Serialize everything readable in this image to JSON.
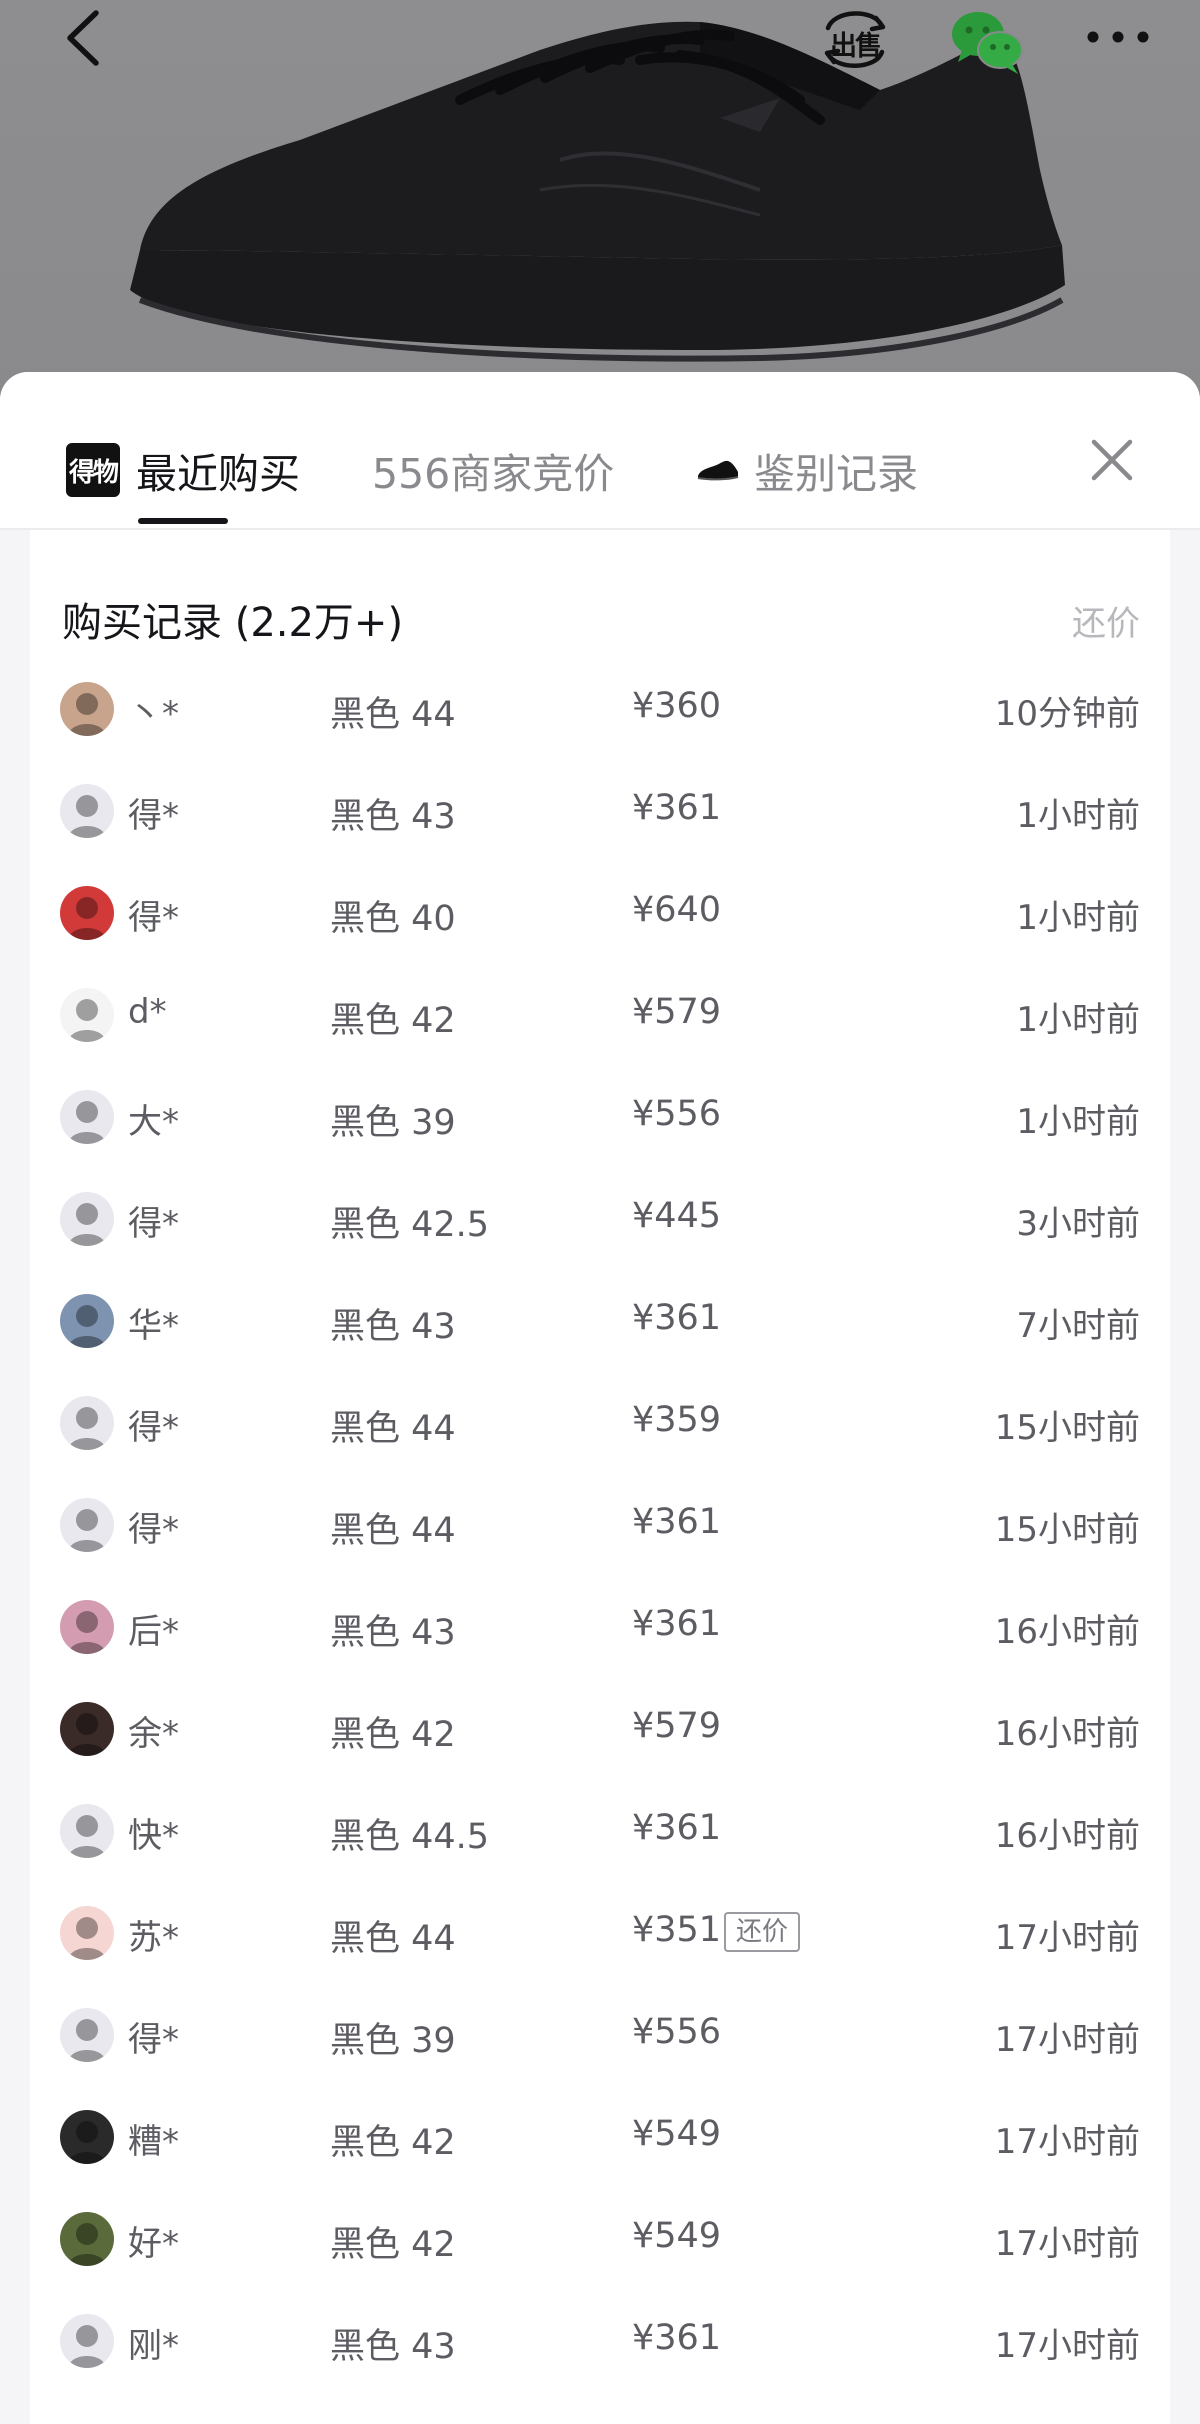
{
  "header": {
    "back_icon": "chevron-left-icon",
    "sell_label": "出售",
    "share_icon": "wechat-icon",
    "more_icon": "more-dots-icon"
  },
  "tabs": {
    "recent": {
      "logo_text": "得物",
      "label": "最近购买"
    },
    "bids": {
      "label": "556商家竞价"
    },
    "auth": {
      "label": "鉴别记录"
    },
    "close_icon": "close-icon"
  },
  "records": {
    "title": "购买记录 (2.2万+)",
    "action": "还价",
    "items": [
      {
        "name": "丶*",
        "spec": "黑色 44",
        "price": "¥360",
        "badge": "",
        "time": "10分钟前",
        "avatar": "#c8a48c"
      },
      {
        "name": "得*",
        "spec": "黑色 43",
        "price": "¥361",
        "badge": "",
        "time": "1小时前",
        "avatar": "#e8e8ee"
      },
      {
        "name": "得*",
        "spec": "黑色 40",
        "price": "¥640",
        "badge": "",
        "time": "1小时前",
        "avatar": "#d23a3a"
      },
      {
        "name": "d*",
        "spec": "黑色 42",
        "price": "¥579",
        "badge": "",
        "time": "1小时前",
        "avatar": "#f4f4f4"
      },
      {
        "name": "大*",
        "spec": "黑色 39",
        "price": "¥556",
        "badge": "",
        "time": "1小时前",
        "avatar": "#e8e8ee"
      },
      {
        "name": "得*",
        "spec": "黑色 42.5",
        "price": "¥445",
        "badge": "",
        "time": "3小时前",
        "avatar": "#e8e8ee"
      },
      {
        "name": "华*",
        "spec": "黑色 43",
        "price": "¥361",
        "badge": "",
        "time": "7小时前",
        "avatar": "#7d93b0"
      },
      {
        "name": "得*",
        "spec": "黑色 44",
        "price": "¥359",
        "badge": "",
        "time": "15小时前",
        "avatar": "#e8e8ee"
      },
      {
        "name": "得*",
        "spec": "黑色 44",
        "price": "¥361",
        "badge": "",
        "time": "15小时前",
        "avatar": "#e8e8ee"
      },
      {
        "name": "后*",
        "spec": "黑色 43",
        "price": "¥361",
        "badge": "",
        "time": "16小时前",
        "avatar": "#d49cb0"
      },
      {
        "name": "余*",
        "spec": "黑色 42",
        "price": "¥579",
        "badge": "",
        "time": "16小时前",
        "avatar": "#3a2a28"
      },
      {
        "name": "快*",
        "spec": "黑色 44.5",
        "price": "¥361",
        "badge": "",
        "time": "16小时前",
        "avatar": "#e8e8ee"
      },
      {
        "name": "苏*",
        "spec": "黑色 44",
        "price": "¥351",
        "badge": "还价",
        "time": "17小时前",
        "avatar": "#f6d6d2"
      },
      {
        "name": "得*",
        "spec": "黑色 39",
        "price": "¥556",
        "badge": "",
        "time": "17小时前",
        "avatar": "#e8e8ee"
      },
      {
        "name": "糟*",
        "spec": "黑色 42",
        "price": "¥549",
        "badge": "",
        "time": "17小时前",
        "avatar": "#2a2a2a"
      },
      {
        "name": "好*",
        "spec": "黑色 42",
        "price": "¥549",
        "badge": "",
        "time": "17小时前",
        "avatar": "#5a6a3a"
      },
      {
        "name": "刚*",
        "spec": "黑色 43",
        "price": "¥361",
        "badge": "",
        "time": "17小时前",
        "avatar": "#e8e8ee"
      }
    ]
  }
}
